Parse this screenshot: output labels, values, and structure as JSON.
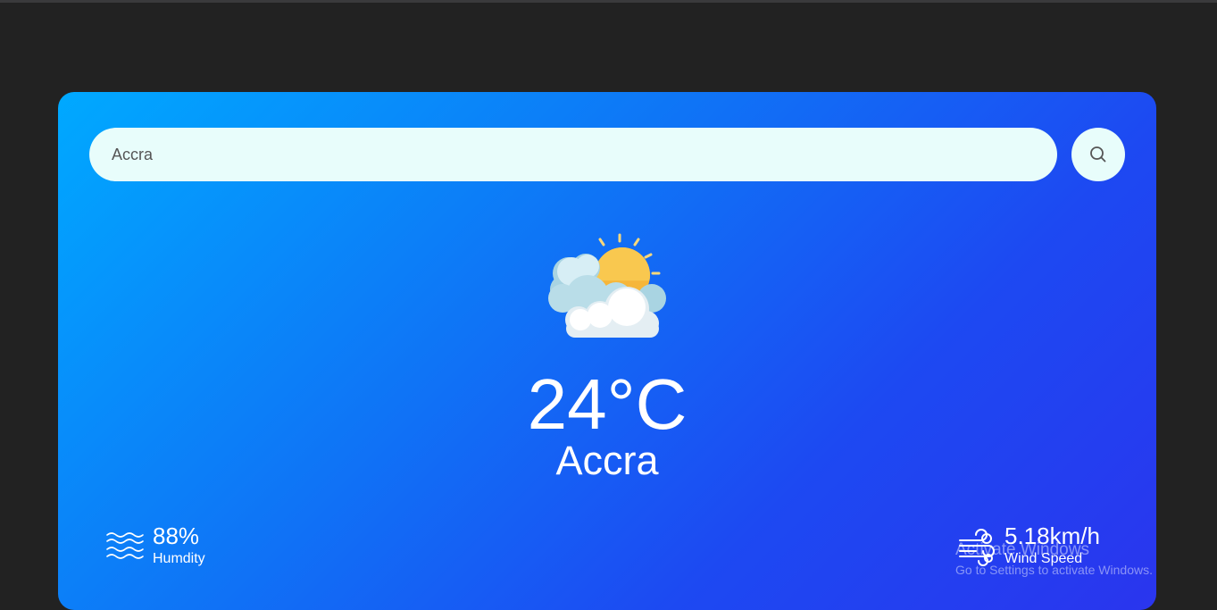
{
  "search": {
    "value": "Accra",
    "placeholder": ""
  },
  "search_button": {
    "icon": "search-icon"
  },
  "weather": {
    "icon": "partly-cloudy-icon",
    "temperature": "24°C",
    "city": "Accra"
  },
  "details": {
    "humidity": {
      "icon": "humidity-waves-icon",
      "value": "88%",
      "label": "Humdity"
    },
    "wind": {
      "icon": "wind-icon",
      "value": "5.18km/h",
      "label": "Wind Speed"
    }
  },
  "watermark": {
    "title": "Activate Windows",
    "subtitle": "Go to Settings to activate Windows."
  },
  "colors": {
    "background": "#222222",
    "card_gradient_start": "#00a9ff",
    "card_gradient_end": "#2a35ee",
    "input_background": "#e8fdfb",
    "text": "#ffffff"
  }
}
